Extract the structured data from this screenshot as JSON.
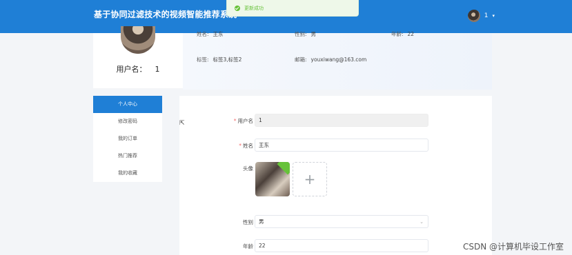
{
  "header": {
    "app_title": "基于协同过滤技术的视频智能推荐系统",
    "user_name": "1",
    "caret": "▾"
  },
  "toast": {
    "message": "更新成功"
  },
  "profile": {
    "username_label": "用户名：",
    "username_value": "1"
  },
  "info": {
    "name_label": "姓名:",
    "name_value": "王东",
    "gender_label": "性别:",
    "gender_value": "男",
    "age_label": "年龄:",
    "age_value": "22",
    "tags_label": "标签:",
    "tags_value": "标签3,标签2",
    "email_label": "邮箱:",
    "email_value": "youxiwang@163.com"
  },
  "sidebar": {
    "items": [
      {
        "label": "个人中心",
        "active": true
      },
      {
        "label": "修改密码",
        "active": false
      },
      {
        "label": "我的订单",
        "active": false
      },
      {
        "label": "热门推荐",
        "active": false
      },
      {
        "label": "我的收藏",
        "active": false
      }
    ]
  },
  "form": {
    "username_label": "用户名",
    "username_value": "1",
    "name_label": "姓名",
    "name_value": "王东",
    "avatar_label": "头像",
    "add_symbol": "+",
    "gender_label": "性别",
    "gender_value": "男",
    "age_label": "年龄",
    "age_value": "22"
  },
  "watermark": "CSDN @计算机毕设工作室",
  "colors": {
    "primary": "#1f7fd6",
    "success": "#67c23a",
    "required": "#f56c6c"
  }
}
